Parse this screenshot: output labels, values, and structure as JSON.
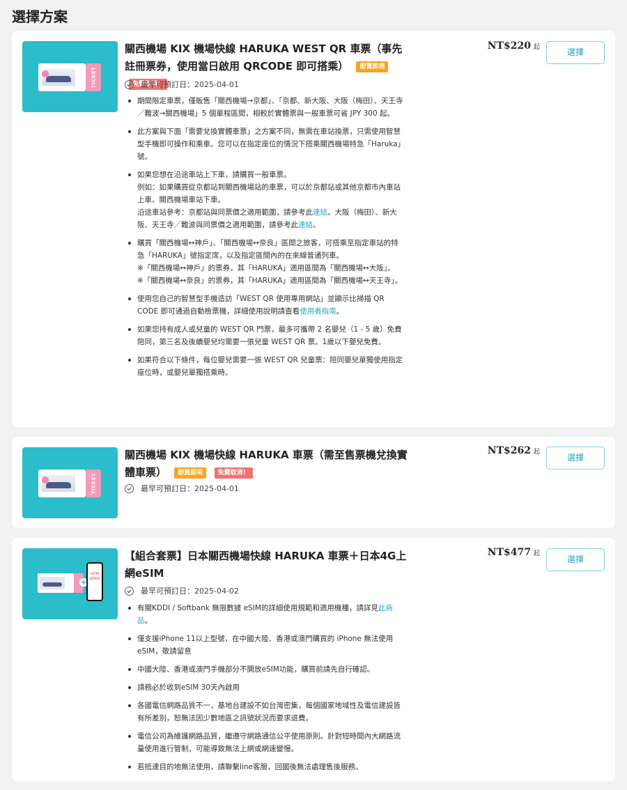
{
  "section_title": "選擇方案",
  "ticket_stub_text": "TICKET",
  "plans": [
    {
      "title": "關西機場 KIX 機場快線 HARUKA WEST QR 車票（事先註冊票券，使用當日啟用 QRCODE 即可搭乘）",
      "badges": [
        "即買即用",
        "免費取消！"
      ],
      "date_label": "最早可預訂日：",
      "date_value": "2025-04-01",
      "price": "NT$220",
      "price_suffix": "起",
      "button": "選擇",
      "bullets": [
        "期間限定車票，僅販售「關西機場→京都」、「京都、新大阪、大阪（梅田）、天王寺／難波→關西機場」5 個單程區間，相較於實體票與一般車票可省 JPY 300 起。",
        "此方案與下面「需要兌換實體車票」之方案不同，無需在車站換票，只需使用智慧型手機即可操作和乘車。您可以在指定座位的情況下搭乘關西機場特急「Haruka」號。",
        "如果您想在沿途車站上下車，請購買一般車票。",
        "例如：如果購買從京都站到關西機場站的車票，可以於京都站或其他京都市內車站上車、關西機場車站下車。",
        "沿途車站參考：京都站與同票價之適用範圍，請參考此",
        "連結",
        "。大阪（梅田）、新大阪、天王寺／難波與同票價之適用範圍，請參考此",
        "連結",
        "。",
        "購買「關西機場↔神戶」、「關西機場↔奈良」區間之旅客，可搭乘至指定車站的特急「HARUKA」號指定席，以及指定區間內的在來線普通列車。",
        "※「關西機場↔神戶」的票券，其「HARUKA」適用區間為「關西機場↔大阪」。",
        "※「關西機場↔奈良」的票券，其「HARUKA」適用區間為「關西機場↔天王寺」。",
        "使用您自己的智慧型手機造訪「WEST QR 使用專用網站」並顯示比掃描 QR CODE 即可通過自動檢票機，詳細使用說明請查看",
        "使用者指南",
        "。",
        "如果您持有成人或兒童的 WEST QR 門票，最多可攜帶 2 名嬰兒（1 - 5 歲）免費陪同，第三名及後續嬰兒均需要一張兒童 WEST QR 票。1歲以下嬰兒免費。",
        "如果符合以下條件，每位嬰兒需要一張 WEST QR 兒童票：陪同嬰兒單獨使用指定座位時，或嬰兒單獨搭乘時。"
      ]
    },
    {
      "title": "關西機場 KIX 機場快線 HARUKA 車票（需至售票機兌換實體車票）",
      "badges": [
        "即買即用",
        "免費取消！"
      ],
      "date_label": "最早可預訂日：",
      "date_value": "2025-04-01",
      "price": "NT$262",
      "price_suffix": "起",
      "button": "選擇"
    },
    {
      "title": "【組合套票】日本關西機場快線 HARUKA 車票＋日本4G上網eSIM",
      "date_label": "最早可預訂日：",
      "date_value": "2025-04-02",
      "price": "NT$477",
      "price_suffix": "起",
      "button": "選擇",
      "esim_screen": "eSIM JAPAN",
      "bullets": [
        "有關KDDI / Softbank 無限數據 eSIM的詳細使用規範和適用機種，請詳見",
        "此商品",
        "。",
        "僅支援iPhone 11以上型號，在中國大陸、香港或澳門購買的 iPhone 無法使用eSIM，敬請留意",
        "中國大陸、香港或澳門手機部分不開放eSIM功能，購買前請先自行確認。",
        "請務必於收到eSIM 30天內啟用",
        "各國電信網路品質不一，基地台建設不如台灣密集，每個國家地域性及電信建設皆有所差別，恕無法因少數地區之訊號狀況而要求退費。",
        "電信公司為維護網路品質，繼遵守網路通信公平使用原則。針對短時間內大網路流量使用進行管制，可能導致無法上網或網速變慢。",
        "若抵達目的地無法使用，請聯繫line客服，回國後無法處理售後服務。"
      ]
    }
  ]
}
